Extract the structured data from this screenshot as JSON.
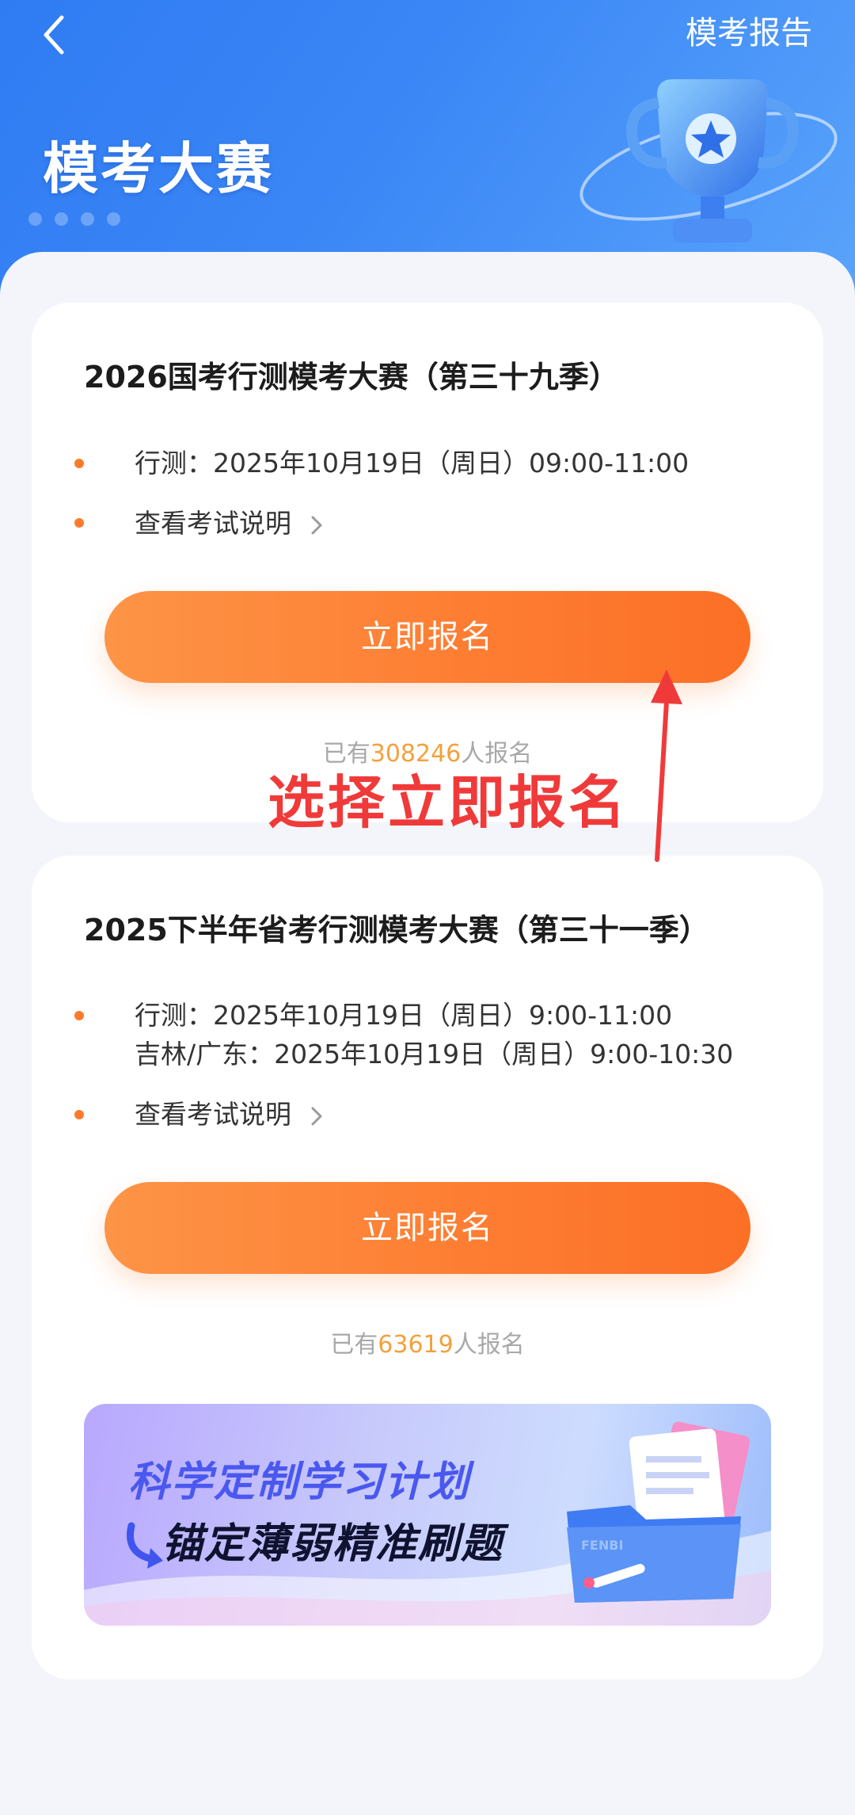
{
  "header": {
    "report_label": "模考报告",
    "title": "模考大赛"
  },
  "contests": [
    {
      "title": "2026国考行测模考大赛（第三十九季）",
      "schedule": [
        "行测：2025年10月19日（周日）09:00-11:00"
      ],
      "guide_label": "查看考试说明",
      "button_label": "立即报名",
      "count_prefix": "已有",
      "count_value": "308246",
      "count_suffix": "人报名"
    },
    {
      "title": "2025下半年省考行测模考大赛（第三十一季）",
      "schedule": [
        "行测：2025年10月19日（周日）9:00-11:00",
        "吉林/广东：2025年10月19日（周日）9:00-10:30"
      ],
      "guide_label": "查看考试说明",
      "button_label": "立即报名",
      "count_prefix": "已有",
      "count_value": "63619",
      "count_suffix": "人报名"
    }
  ],
  "annotation": {
    "text": "选择立即报名",
    "color": "#f03a3a"
  },
  "banner": {
    "line1": "科学定制学习计划",
    "line2": "锚定薄弱精准刷题",
    "folder_label": "FENBI"
  },
  "colors": {
    "accent_orange": "#fd7e33",
    "header_blue": "#3b87f6",
    "count_orange": "#f3a13c"
  },
  "icons": {
    "back": "chevron-left-icon",
    "guide": "chevron-right-icon",
    "trophy": "trophy-icon",
    "arrow": "arrow-up-icon"
  }
}
